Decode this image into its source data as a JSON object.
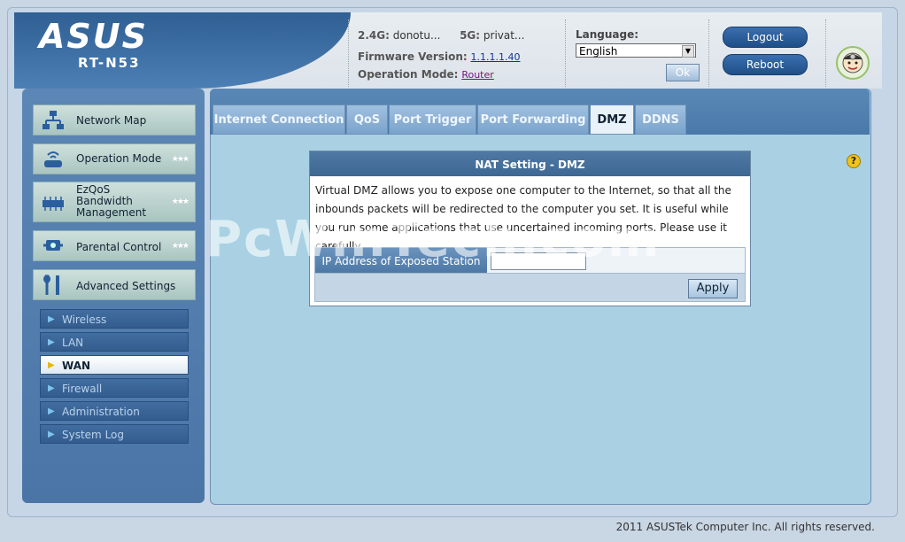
{
  "header": {
    "brand": "ASUS",
    "model": "RT-N53",
    "ssid_24_label": "2.4G:",
    "ssid_24_value": "donotu...",
    "ssid_5_label": "5G:",
    "ssid_5_value": "privat...",
    "firmware_label": "Firmware Version:",
    "firmware_value": "1.1.1.1.40",
    "opmode_label": "Operation Mode:",
    "opmode_value": "Router",
    "language_label": "Language:",
    "language_value": "English",
    "ok_label": "Ok",
    "logout_label": "Logout",
    "reboot_label": "Reboot"
  },
  "sidebar": {
    "items": [
      {
        "label": "Network Map",
        "icon": "network-map-icon"
      },
      {
        "label": "Operation Mode",
        "icon": "router-icon"
      },
      {
        "label": "EzQoS Bandwidth Management",
        "label_lines": [
          "EzQoS",
          "Bandwidth",
          "Management"
        ],
        "icon": "qos-icon"
      },
      {
        "label": "Parental Control",
        "icon": "parental-control-icon"
      },
      {
        "label": "Advanced Settings",
        "icon": "wrench-icon"
      }
    ],
    "submenu": [
      {
        "label": "Wireless"
      },
      {
        "label": "LAN"
      },
      {
        "label": "WAN",
        "active": true
      },
      {
        "label": "Firewall"
      },
      {
        "label": "Administration"
      },
      {
        "label": "System Log"
      }
    ]
  },
  "tabs": [
    {
      "label": "Internet Connection"
    },
    {
      "label": "QoS"
    },
    {
      "label": "Port Trigger"
    },
    {
      "label": "Port Forwarding"
    },
    {
      "label": "DMZ",
      "active": true
    },
    {
      "label": "DDNS"
    }
  ],
  "panel": {
    "title": "NAT Setting - DMZ",
    "description": "Virtual DMZ allows you to expose one computer to the Internet, so that all the inbounds packets will be redirected to the computer you set. It is useful while you run some applications that use uncertained incoming ports. Please use it carefully.",
    "field_label": "IP Address of Exposed Station",
    "field_value": "",
    "apply_label": "Apply"
  },
  "watermark": "PcWinTech.com",
  "footer": "2011 ASUSTek Computer Inc. All rights reserved.",
  "colors": {
    "accent": "#4a78a8",
    "content_bg": "#a9d1e3",
    "header_bg": "#2f5f93"
  }
}
